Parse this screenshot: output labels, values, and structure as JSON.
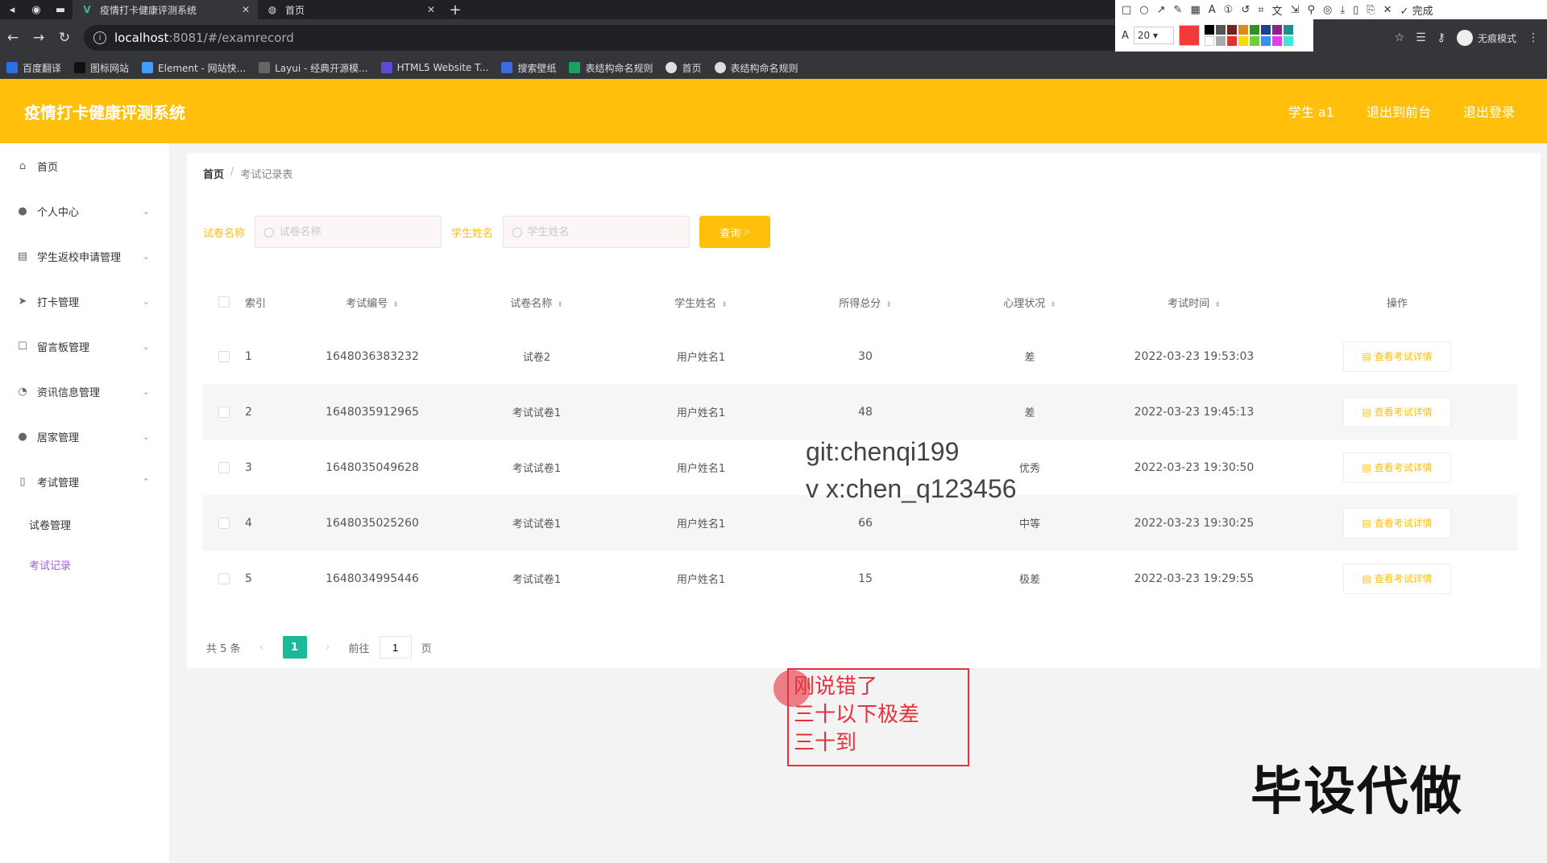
{
  "browser": {
    "tabs": [
      {
        "title": "疫情打卡健康评测系统",
        "active": true
      },
      {
        "title": "首页",
        "active": false
      }
    ],
    "url_host": "localhost",
    "url_path": ":8081/#/examrecord",
    "incognito_label": "无痕模式",
    "bookmarks": [
      "百度翻译",
      "图标网站",
      "Element - 网站快...",
      "Layui - 经典开源模...",
      "HTML5 Website T...",
      "搜索壁纸",
      "表结构命名规则",
      "首页",
      "表结构命名规则"
    ],
    "screenshot_tool": {
      "done_label": "完成",
      "font_size": "20",
      "current_color": "#f23a3a"
    }
  },
  "app": {
    "title": "疫情打卡健康评测系统",
    "header_links": [
      "学生 a1",
      "退出到前台",
      "退出登录"
    ]
  },
  "sidebar": {
    "items": [
      {
        "label": "首页",
        "icon": "home-icon"
      },
      {
        "label": "个人中心",
        "icon": "user-icon"
      },
      {
        "label": "学生返校申请管理",
        "icon": "clipboard-icon"
      },
      {
        "label": "打卡管理",
        "icon": "send-icon"
      },
      {
        "label": "留言板管理",
        "icon": "square-icon"
      },
      {
        "label": "资讯信息管理",
        "icon": "compass-icon"
      },
      {
        "label": "居家管理",
        "icon": "user-icon"
      },
      {
        "label": "考试管理",
        "icon": "phone-icon"
      }
    ],
    "sub_items": [
      {
        "label": "试卷管理",
        "active": false
      },
      {
        "label": "考试记录",
        "active": true
      }
    ]
  },
  "breadcrumb": {
    "home": "首页",
    "sep": "/",
    "current": "考试记录表"
  },
  "search": {
    "paper_label": "试卷名称",
    "paper_placeholder": "试卷名称",
    "student_label": "学生姓名",
    "student_placeholder": "学生姓名",
    "button_label": "查询"
  },
  "table": {
    "columns": [
      "索引",
      "考试编号",
      "试卷名称",
      "学生姓名",
      "所得总分",
      "心理状况",
      "考试时间",
      "操作"
    ],
    "rows": [
      {
        "index": "1",
        "id": "1648036383232",
        "paper": "试卷2",
        "student": "用户姓名1",
        "score": "30",
        "mental": "差",
        "time": "2022-03-23 19:53:03"
      },
      {
        "index": "2",
        "id": "1648035912965",
        "paper": "考试试卷1",
        "student": "用户姓名1",
        "score": "48",
        "mental": "差",
        "time": "2022-03-23 19:45:13"
      },
      {
        "index": "3",
        "id": "1648035049628",
        "paper": "考试试卷1",
        "student": "用户姓名1",
        "score": "",
        "mental": "优秀",
        "time": "2022-03-23 19:30:50"
      },
      {
        "index": "4",
        "id": "1648035025260",
        "paper": "考试试卷1",
        "student": "用户姓名1",
        "score": "66",
        "mental": "中等",
        "time": "2022-03-23 19:30:25"
      },
      {
        "index": "5",
        "id": "1648034995446",
        "paper": "考试试卷1",
        "student": "用户姓名1",
        "score": "15",
        "mental": "极差",
        "time": "2022-03-23 19:29:55"
      }
    ],
    "detail_label": "查看考试详情"
  },
  "pagination": {
    "total": "共 5 条",
    "current": "1",
    "goto_prefix": "前往",
    "goto_value": "1",
    "goto_suffix": "页"
  },
  "overlays": {
    "watermark_line1": "git:chenqi199",
    "watermark_line2": "v x:chen_q123456",
    "annotation": [
      "刚说错了",
      "三十以下极差",
      "三十到"
    ],
    "promo": "毕设代做"
  },
  "colors": {
    "primary": "#ffbf0b",
    "page_active": "#19b999",
    "submenu_active": "#a35fd7",
    "annotation": "#e8313c"
  }
}
